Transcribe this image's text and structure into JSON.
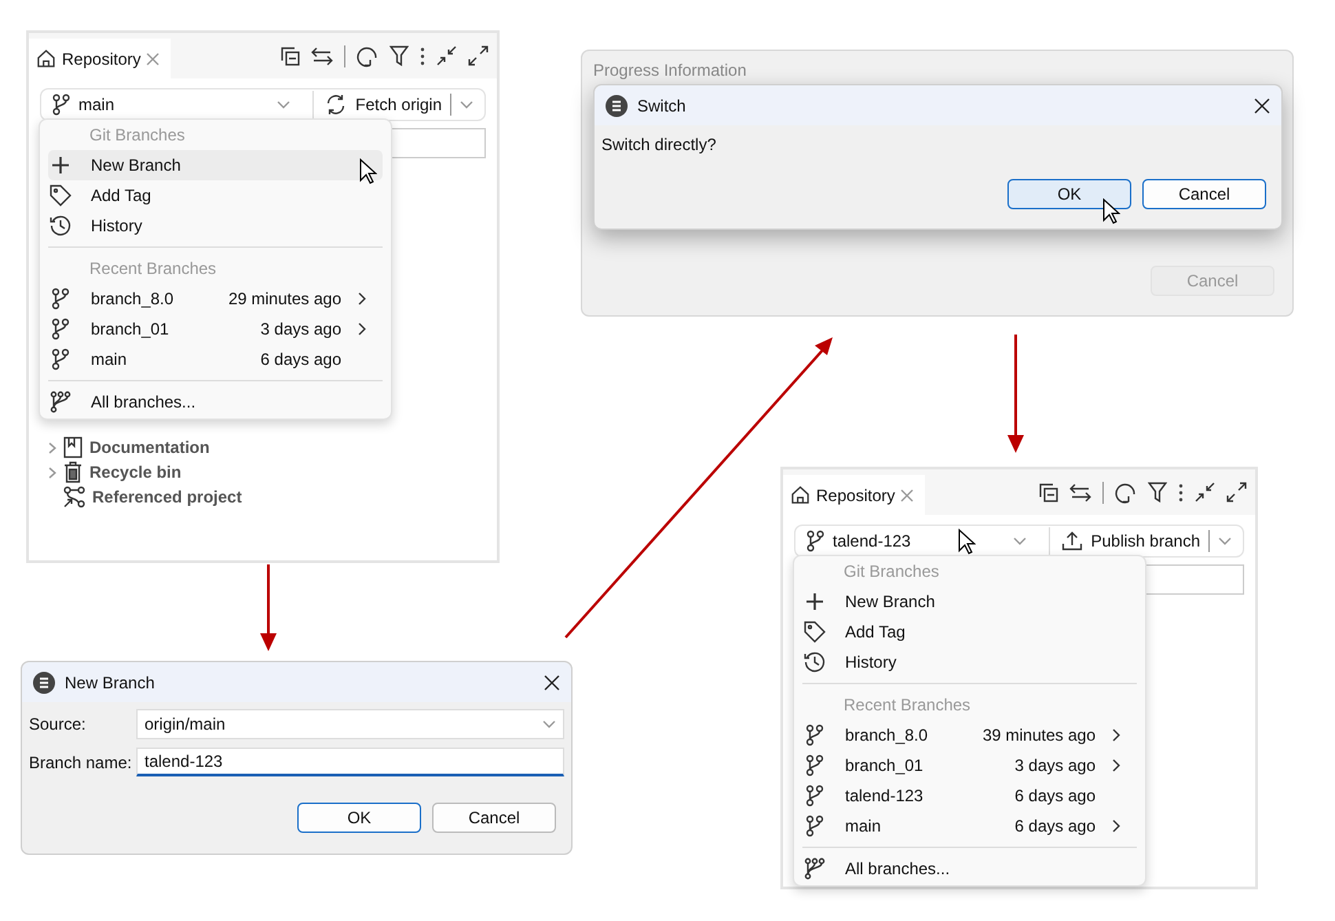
{
  "repository_views": [
    {
      "tab_label": "Repository",
      "branch": "main",
      "pointer_on_branch_button": false,
      "action": {
        "kind": "fetch",
        "label": "Fetch origin"
      },
      "menu": {
        "actions_heading": "Git Branches",
        "actions": [
          {
            "kind": "new",
            "label": "New Branch",
            "hovered": true,
            "pointer": true
          },
          {
            "kind": "tag",
            "label": "Add Tag",
            "hovered": false
          },
          {
            "kind": "history",
            "label": "History",
            "hovered": false
          }
        ],
        "recent_heading": "Recent Branches",
        "recent": [
          {
            "name": "branch_8.0",
            "time": "29 minutes ago",
            "has_submenu": true
          },
          {
            "name": "branch_01",
            "time": "3 days ago",
            "has_submenu": true
          },
          {
            "name": "main",
            "time": "6 days ago",
            "has_submenu": false
          }
        ],
        "footer": "All branches..."
      },
      "tree": [
        {
          "kind": "documentation",
          "label": "Documentation",
          "expandable": true
        },
        {
          "kind": "recycle",
          "label": "Recycle bin",
          "expandable": true
        },
        {
          "kind": "referenced",
          "label": "Referenced project",
          "expandable": false
        }
      ]
    },
    {
      "tab_label": "Repository",
      "branch": "talend-123",
      "pointer_on_branch_button": true,
      "action": {
        "kind": "publish",
        "label": "Publish branch"
      },
      "menu": {
        "actions_heading": "Git Branches",
        "actions": [
          {
            "kind": "new",
            "label": "New Branch",
            "hovered": false
          },
          {
            "kind": "tag",
            "label": "Add Tag",
            "hovered": false
          },
          {
            "kind": "history",
            "label": "History",
            "hovered": false
          }
        ],
        "recent_heading": "Recent Branches",
        "recent": [
          {
            "name": "branch_8.0",
            "time": "39 minutes ago",
            "has_submenu": true
          },
          {
            "name": "branch_01",
            "time": "3 days ago",
            "has_submenu": true
          },
          {
            "name": "talend-123",
            "time": "6 days ago",
            "has_submenu": false
          },
          {
            "name": "main",
            "time": "6 days ago",
            "has_submenu": true
          }
        ],
        "footer": "All branches..."
      }
    }
  ],
  "new_branch_dialog": {
    "title": "New Branch",
    "fields": [
      {
        "kind": "dropdown",
        "label": "Source:",
        "value": "origin/main",
        "focused": false
      },
      {
        "kind": "text",
        "label": "Branch name:",
        "value": "talend-123",
        "focused": true
      }
    ],
    "buttons": [
      {
        "label": "OK",
        "default": true,
        "hovered": false
      },
      {
        "label": "Cancel",
        "default": false,
        "hovered": false
      }
    ]
  },
  "progress_dialog": {
    "title": "Progress Information",
    "buttons": [
      {
        "label": "Cancel",
        "disabled": true
      }
    ],
    "child_dialog": {
      "title": "Switch",
      "message": "Switch directly?",
      "buttons": [
        {
          "label": "OK",
          "default": true,
          "hovered": true
        },
        {
          "label": "Cancel",
          "default": true,
          "hovered": false
        }
      ]
    }
  }
}
